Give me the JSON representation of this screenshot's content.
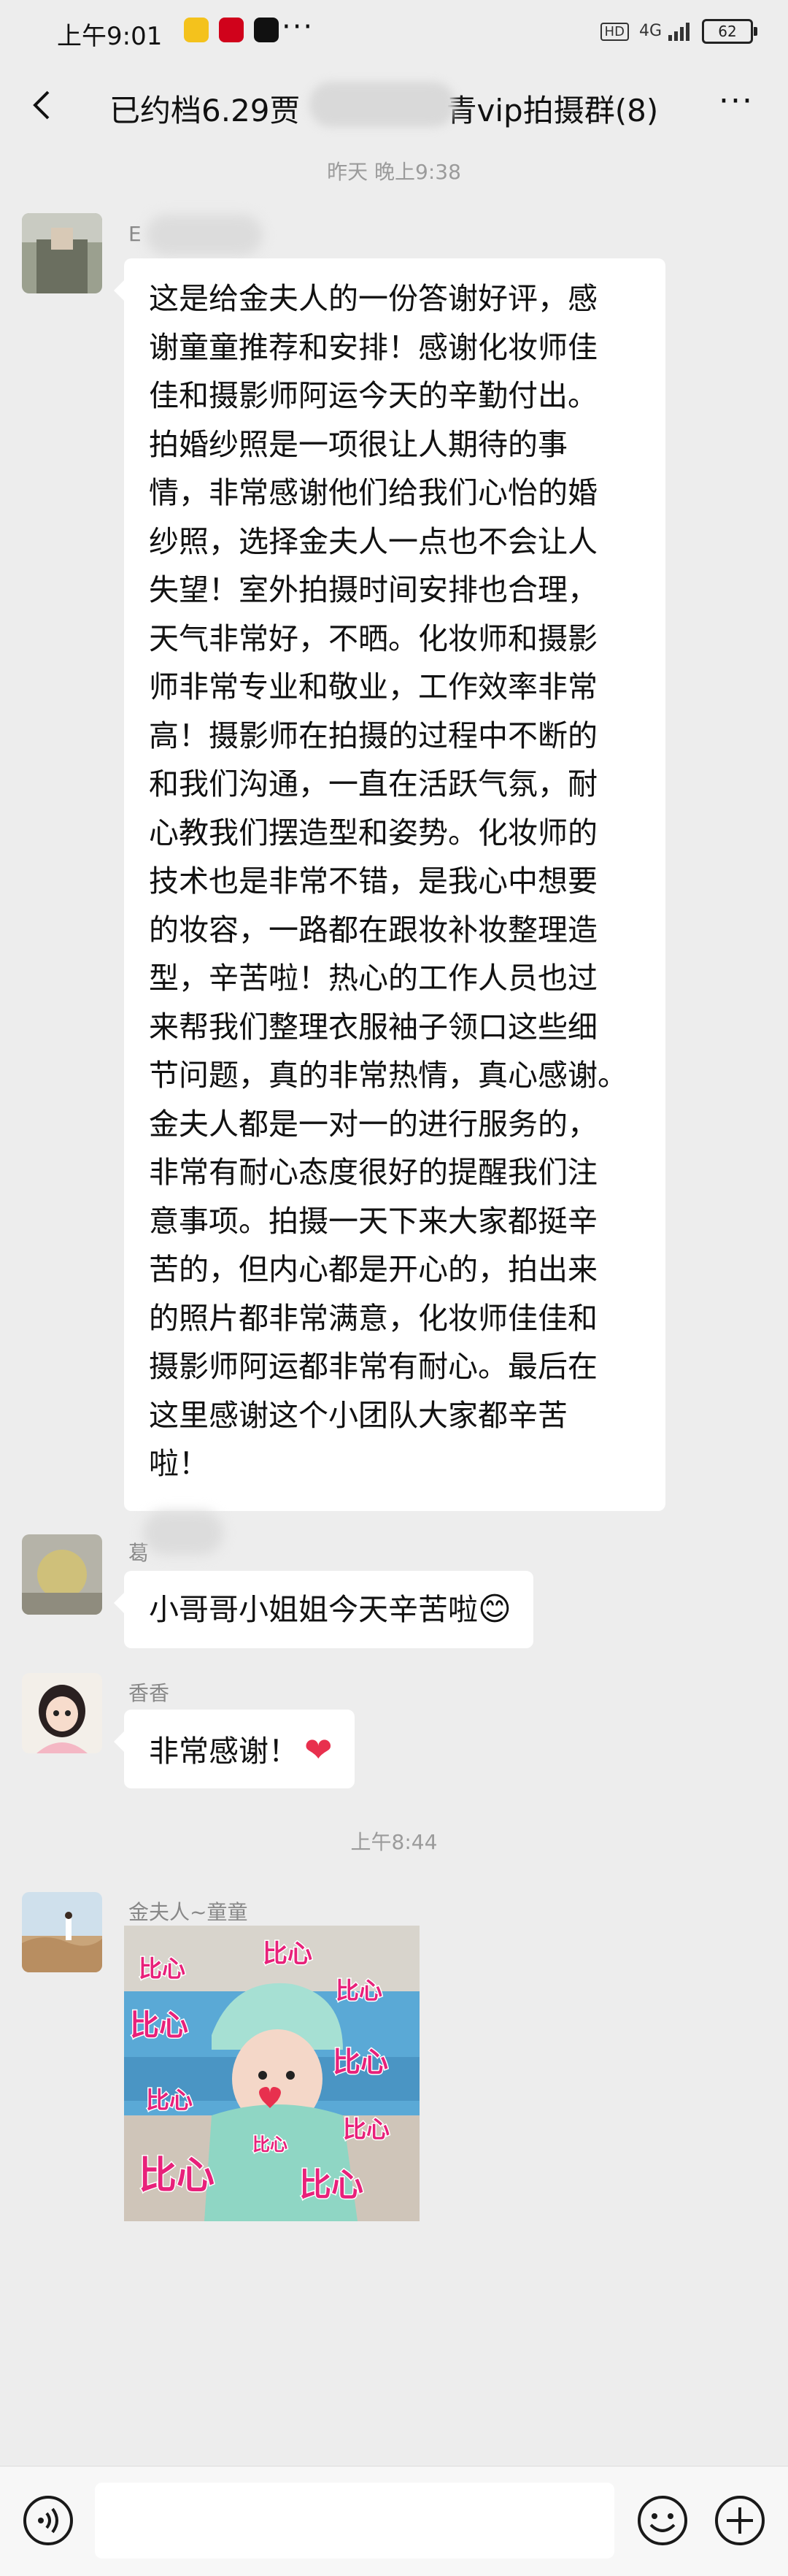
{
  "status_bar": {
    "time": "上午9:01",
    "hd": "HD",
    "network": "4G",
    "battery": "62",
    "more_dots": "···"
  },
  "header": {
    "title": "已约档6.29贾",
    "title_suffix": "青vip拍摄群(8)"
  },
  "chat": {
    "timestamp_1": "昨天 晚上9:38",
    "msg1_sender": "E",
    "msg1_text": "这是给金夫人的一份答谢好评，感谢童童推荐和安排！感谢化妆师佳佳和摄影师阿运今天的辛勤付出。拍婚纱照是一项很让人期待的事情，非常感谢他们给我们心怡的婚纱照，选择金夫人一点也不会让人失望！室外拍摄时间安排也合理，天气非常好，不晒。化妆师和摄影师非常专业和敬业，工作效率非常高！摄影师在拍摄的过程中不断的和我们沟通，一直在活跃气氛，耐心教我们摆造型和姿势。化妆师的技术也是非常不错，是我心中想要的妆容，一路都在跟妆补妆整理造型，辛苦啦！热心的工作人员也过来帮我们整理衣服袖子领口这些细节问题，真的非常热情，真心感谢。金夫人都是一对一的进行服务的，非常有耐心态度很好的提醒我们注意事项。拍摄一天下来大家都挺辛苦的，但内心都是开心的，拍出来的照片都非常满意，化妆师佳佳和摄影师阿运都非常有耐心。最后在这里感谢这个小团队大家都辛苦啦！",
    "msg1_lines": [
      "这是给金夫人的一份答谢好评，感",
      "谢童童推荐和安排！感谢化妆师佳",
      "佳和摄影师阿运今天的辛勤付出。",
      "拍婚纱照是一项很让人期待的事",
      "情，非常感谢他们给我们心怡的婚",
      "纱照，选择金夫人一点也不会让人",
      "失望！室外拍摄时间安排也合理，",
      "天气非常好，不晒。化妆师和摄影",
      "师非常专业和敬业，工作效率非常",
      "高！摄影师在拍摄的过程中不断的",
      "和我们沟通，一直在活跃气氛，耐",
      "心教我们摆造型和姿势。化妆师的",
      "技术也是非常不错，是我心中想要",
      "的妆容，一路都在跟妆补妆整理造",
      "型，辛苦啦！热心的工作人员也过",
      "来帮我们整理衣服袖子领口这些细",
      "节问题，真的非常热情，真心感谢。",
      "金夫人都是一对一的进行服务的，",
      "非常有耐心态度很好的提醒我们注",
      "意事项。拍摄一天下来大家都挺辛",
      "苦的，但内心都是开心的，拍出来",
      "的照片都非常满意，化妆师佳佳和",
      "摄影师阿运都非常有耐心。最后在",
      "这里感谢这个小团队大家都辛苦",
      "啦！"
    ],
    "msg2_sender": "葛",
    "msg2_text": "小哥哥小姐姐今天辛苦啦",
    "msg2_emoji": "😊",
    "msg3_sender": "香香",
    "msg3_text": "非常感谢！",
    "msg3_emoji": "❤",
    "timestamp_2": "上午8:44",
    "msg4_sender": "金夫人~童童",
    "sticker_words": [
      "比心",
      "比心",
      "比心",
      "比心",
      "比心",
      "比心",
      "比心",
      "比心",
      "比心",
      "比心"
    ]
  },
  "input": {
    "placeholder": ""
  },
  "colors": {
    "background": "#ededed",
    "bubble": "#ffffff",
    "sticker_text": "#e8217a",
    "heart": "#e8304e"
  }
}
